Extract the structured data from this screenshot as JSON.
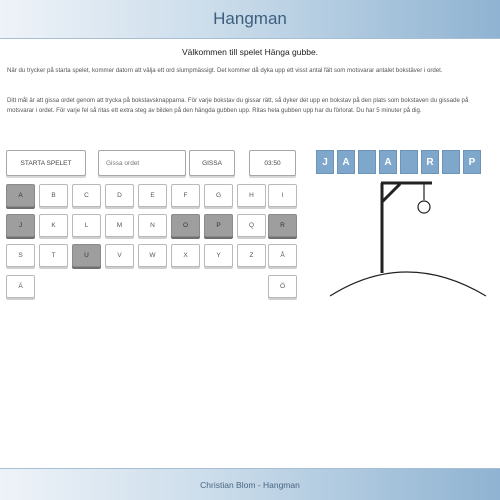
{
  "header": {
    "title": "Hangman"
  },
  "welcome": "Välkommen till spelet Hänga gubbe.",
  "intro": {
    "p1": "När du trycker på starta spelet, kommer datorn att välja ett ord slumpmässigt. Det kommer då dyka upp ett visst antal fält som motsvarar antalet bokstäver i ordet.",
    "p2": "Ditt mål är att gissa ordet genom att trycka på bokstavsknapparna. För varje bokstav du gissar rätt, så dyker det upp en bokstav på den plats som bokstaven du gissade på motsvarar i ordet. För varje fel så ritas ett extra steg av bilden på den hängda gubben upp. Ritas hela gubben upp har du förlorat. Du har 5 minuter på dig."
  },
  "controls": {
    "start_label": "STARTA SPELET",
    "guess_placeholder": "Gissa ordet",
    "guess_value": "",
    "guess_button": "GISSA",
    "timer": "03:50"
  },
  "keyboard": [
    {
      "letter": "A",
      "used": true
    },
    {
      "letter": "B",
      "used": false
    },
    {
      "letter": "C",
      "used": false
    },
    {
      "letter": "D",
      "used": false
    },
    {
      "letter": "E",
      "used": false
    },
    {
      "letter": "F",
      "used": false
    },
    {
      "letter": "G",
      "used": false
    },
    {
      "letter": "H",
      "used": false
    },
    {
      "letter": "I",
      "used": false
    },
    {
      "letter": "J",
      "used": true
    },
    {
      "letter": "K",
      "used": false
    },
    {
      "letter": "L",
      "used": false
    },
    {
      "letter": "M",
      "used": false
    },
    {
      "letter": "N",
      "used": false
    },
    {
      "letter": "O",
      "used": true
    },
    {
      "letter": "P",
      "used": true
    },
    {
      "letter": "Q",
      "used": false
    },
    {
      "letter": "R",
      "used": true
    },
    {
      "letter": "S",
      "used": false
    },
    {
      "letter": "T",
      "used": false
    },
    {
      "letter": "U",
      "used": true
    },
    {
      "letter": "V",
      "used": false
    },
    {
      "letter": "W",
      "used": false
    },
    {
      "letter": "X",
      "used": false
    },
    {
      "letter": "Y",
      "used": false
    },
    {
      "letter": "Z",
      "used": false
    },
    {
      "letter": "Å",
      "used": false
    },
    {
      "letter": "Ä",
      "used": false
    },
    {
      "letter": "Ö",
      "used": false
    }
  ],
  "word": [
    "J",
    "A",
    "",
    "A",
    "",
    "R",
    "",
    "P"
  ],
  "colors": {
    "accent": "#7fa7cc",
    "used_key": "#9e9e9e"
  },
  "footer": {
    "text": "Christian Blom - Hangman"
  }
}
